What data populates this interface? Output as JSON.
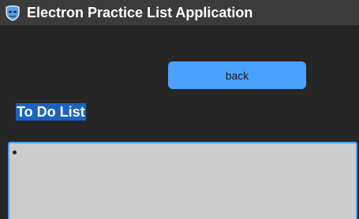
{
  "window": {
    "title": "Electron Practice List Application",
    "icon": "masked-face-icon"
  },
  "toolbar": {
    "back_label": "back"
  },
  "main": {
    "heading": "To Do List",
    "todo_items": [
      {
        "text": ""
      }
    ]
  },
  "colors": {
    "background": "#262626",
    "titlebar": "#3b3b3b",
    "accent": "#4aa1ff",
    "heading_highlight": "#1a62c4",
    "list_background": "#cccccc"
  }
}
